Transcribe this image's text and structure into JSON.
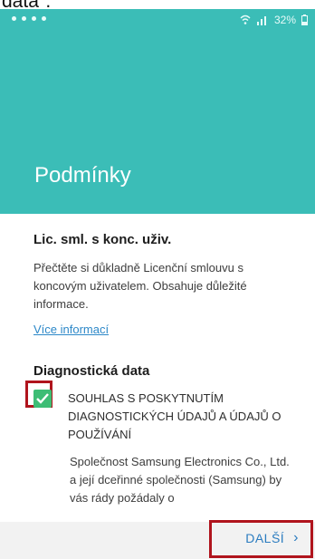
{
  "caption_fragment": "data\".",
  "status_bar": {
    "battery": "32%"
  },
  "header": {
    "title": "Podmínky"
  },
  "sections": {
    "eula": {
      "title": "Lic. sml. s konc. uživ.",
      "text": "Přečtěte si důkladně Licenční smlouvu s koncovým uživatelem. Obsahuje důležité informace.",
      "more_link": "Více informací"
    },
    "diagnostics": {
      "title": "Diagnostická data",
      "consent_label": "SOUHLAS S POSKYTNUTÍM DIAGNOSTICKÝCH ÚDAJŮ A ÚDAJŮ O POUŽÍVÁNÍ",
      "consent_checked": true,
      "body": "Společnost Samsung Electronics Co., Ltd. a její dceřinné společnosti (Samsung) by vás rády požádaly o"
    }
  },
  "footer": {
    "next_label": "DALŠÍ"
  },
  "colors": {
    "header": "#3bbdb7",
    "link": "#2d88c8",
    "checkbox": "#3dbd75",
    "highlight": "#b0141d"
  }
}
